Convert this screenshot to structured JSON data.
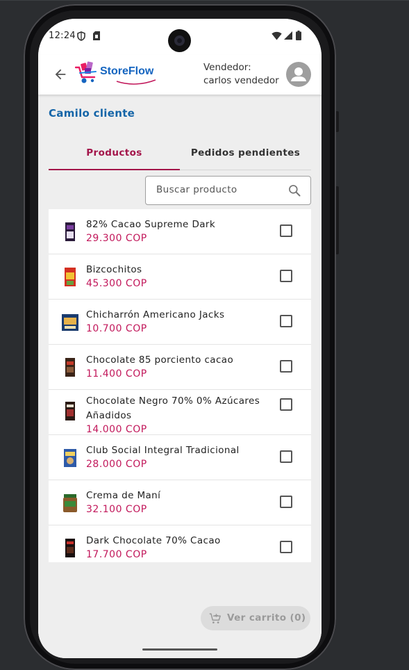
{
  "status_bar": {
    "time": "12:24"
  },
  "app_bar": {
    "logo_text": "StoreFlow",
    "vendor_label": "Vendedor:",
    "vendor_name": "carlos vendedor"
  },
  "client": {
    "name": "Camilo cliente"
  },
  "tabs": [
    {
      "label": "Productos",
      "active": true
    },
    {
      "label": "Pedidos pendientes",
      "active": false
    }
  ],
  "search": {
    "placeholder": "Buscar producto",
    "value": ""
  },
  "products": [
    {
      "name": "82% Cacao Supreme Dark",
      "price": "29.300 COP",
      "checked": false
    },
    {
      "name": "Bizcochitos",
      "price": "45.300 COP",
      "checked": false
    },
    {
      "name": "Chicharrón Americano Jacks",
      "price": "10.700 COP",
      "checked": false
    },
    {
      "name": "Chocolate 85 porciento cacao",
      "price": "11.400 COP",
      "checked": false
    },
    {
      "name": "Chocolate Negro 70% 0% Azúcares Añadidos",
      "price": "14.000 COP",
      "checked": false
    },
    {
      "name": "Club Social Integral Tradicional",
      "price": "28.000 COP",
      "checked": false
    },
    {
      "name": "Crema de Maní",
      "price": "32.100 COP",
      "checked": false
    },
    {
      "name": "Dark Chocolate 70% Cacao",
      "price": "17.700 COP",
      "checked": false
    }
  ],
  "cart_button": {
    "label": "Ver carrito (0)"
  },
  "colors": {
    "accent": "#a3154a",
    "price": "#c2185b",
    "client": "#1565a8",
    "brand": "#1565c0"
  }
}
